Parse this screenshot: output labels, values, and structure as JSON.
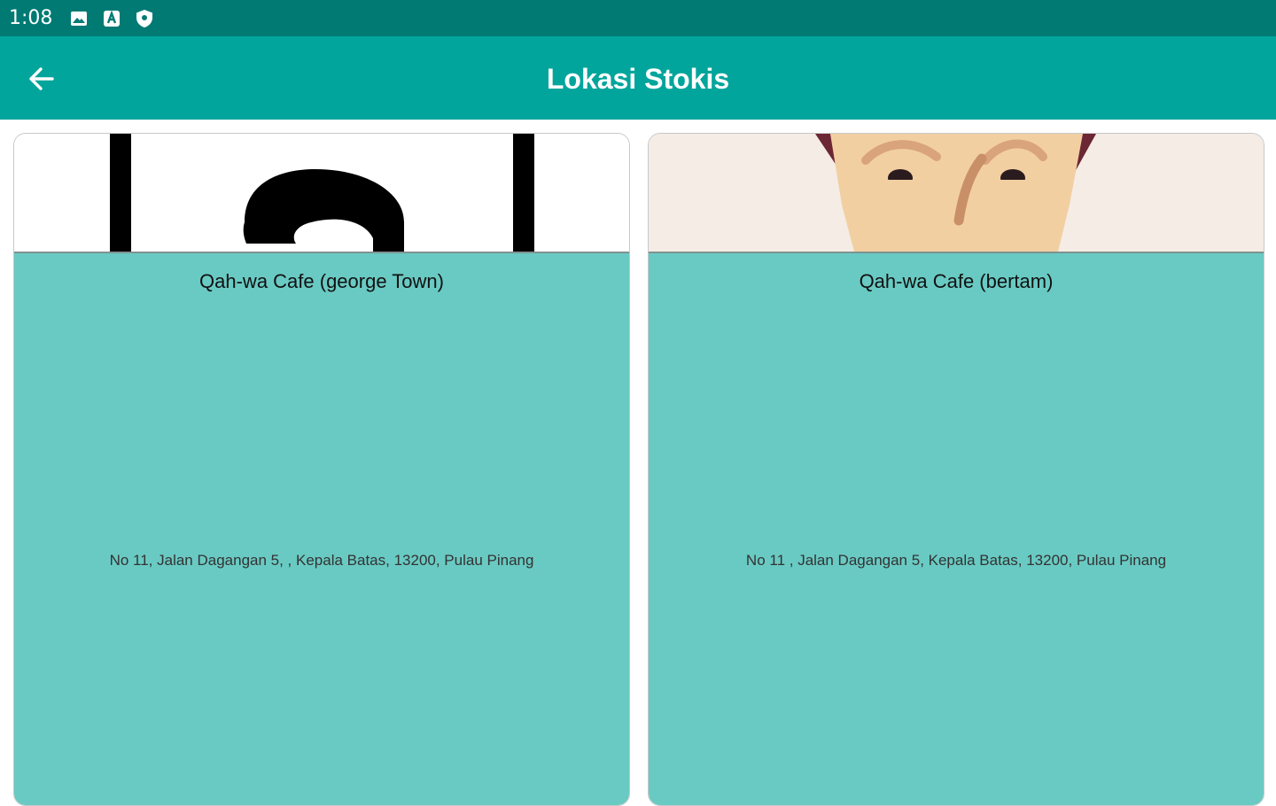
{
  "status_bar": {
    "time": "1:08",
    "icons": [
      "image-icon",
      "a-icon",
      "shield-icon"
    ]
  },
  "app_bar": {
    "back_icon": "arrow-left-icon",
    "title": "Lokasi Stokis"
  },
  "stockists": [
    {
      "name": "Qah-wa Cafe (george Town)",
      "address": "No 11, Jalan Dagangan 5, , Kepala Batas, 13200, Pulau Pinang"
    },
    {
      "name": "Qah-wa Cafe (bertam)",
      "address": "No 11 , Jalan Dagangan 5, Kepala Batas, 13200, Pulau Pinang"
    }
  ],
  "colors": {
    "status_bar": "#017a74",
    "app_bar": "#02a59c",
    "card_body": "#69cac3"
  }
}
